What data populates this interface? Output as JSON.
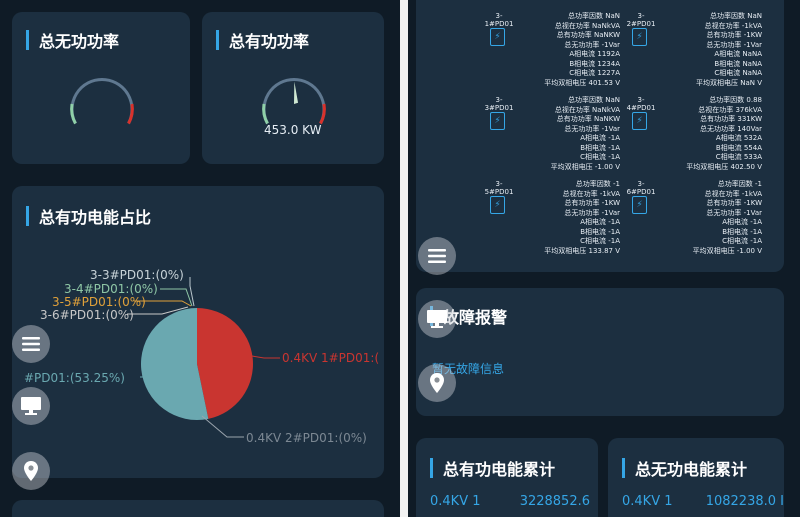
{
  "left": {
    "reactive_power": {
      "title": "总无功功率"
    },
    "active_power": {
      "title": "总有功功率",
      "value": "453.0 KW",
      "level": 0.25
    },
    "energy_share": {
      "title": "总有功电能占比",
      "labels": {
        "l1": "3-3#PD01:(0%)",
        "l2": "3-4#PD01:(0%)",
        "l3": "3-5#PD01:(0%)",
        "l4": "3-6#PD01:(0%)",
        "l5": "#PD01:(53.25%)",
        "l6": "0.4KV 1#PD01:(",
        "l7": "0.4KV 2#PD01:(0%)"
      }
    }
  },
  "chart_data": {
    "type": "pie",
    "slices": [
      {
        "label": "0.4KV 1#PD01",
        "percent": 46.75,
        "color": "#c93530"
      },
      {
        "label": "0.4KV 2#PD01",
        "percent": 0,
        "color": "#9aa4ad"
      },
      {
        "label": "#PD01",
        "percent": 53.25,
        "color": "#6aa8b0"
      },
      {
        "label": "3-3#PD01",
        "percent": 0,
        "color": "#b9c6cc"
      },
      {
        "label": "3-4#PD01",
        "percent": 0,
        "color": "#8fc7a6"
      },
      {
        "label": "3-5#PD01",
        "percent": 0,
        "color": "#e0a13a"
      },
      {
        "label": "3-6#PD01",
        "percent": 0,
        "color": "#c8c8c8"
      }
    ]
  },
  "right": {
    "devices": [
      {
        "name": "3-1#PD01",
        "lines": [
          "总功率因数 NaN",
          "总视在功率 NaNkVA",
          "总有功功率 NaNKW",
          "总无功功率 -1Var",
          "A相电流 1192A",
          "B相电流 1234A",
          "C相电流 1227A",
          "平均双相电压 401.53 V"
        ]
      },
      {
        "name": "3-2#PD01",
        "lines": [
          "总功率因数 NaN",
          "总视在功率 -1kVA",
          "总有功功率 -1KW",
          "总无功功率 -1Var",
          "A相电流 NaNA",
          "B相电流 NaNA",
          "C相电流 NaNA",
          "平均双相电压 NaN V"
        ]
      },
      {
        "name": "3-3#PD01",
        "lines": [
          "总功率因数 NaN",
          "总视在功率 NaNkVA",
          "总有功功率 NaNKW",
          "总无功功率 -1Var",
          "A相电流 -1A",
          "B相电流 -1A",
          "C相电流 -1A",
          "平均双相电压 -1.00 V"
        ]
      },
      {
        "name": "3-4#PD01",
        "lines": [
          "总功率因数 0.88",
          "总视在功率 376kVA",
          "总有功功率 331KW",
          "总无功功率 140Var",
          "A相电流 532A",
          "B相电流 554A",
          "C相电流 533A",
          "平均双相电压 402.50 V"
        ]
      },
      {
        "name": "3-5#PD01",
        "lines": [
          "总功率因数 -1",
          "总视在功率 -1kVA",
          "总有功功率 -1KW",
          "总无功功率 -1Var",
          "A相电流 -1A",
          "B相电流 -1A",
          "C相电流 -1A",
          "平均双相电压 133.87 V"
        ]
      },
      {
        "name": "3-6#PD01",
        "lines": [
          "总功率因数 -1",
          "总视在功率 -1kVA",
          "总有功功率 -1KW",
          "总无功功率 -1Var",
          "A相电流 -1A",
          "B相电流 -1A",
          "C相电流 -1A",
          "平均双相电压 -1.00 V"
        ]
      }
    ],
    "fault": {
      "title": "故障报警",
      "empty": "暂无故障信息"
    },
    "active_energy": {
      "title": "总有功电能累计",
      "label": "0.4KV 1",
      "value": "3228852.6"
    },
    "reactive_energy": {
      "title": "总无功电能累计",
      "label": "0.4KV 1",
      "value": "1082238.0 I"
    }
  },
  "icons": {
    "menu": "menu-icon",
    "monitor": "monitor-icon",
    "location": "location-pin-icon",
    "device": "lightning-icon"
  },
  "colors": {
    "accent": "#35a6e6",
    "card": "#1c2f40",
    "background": "#0f1b26",
    "red": "#c93530"
  }
}
